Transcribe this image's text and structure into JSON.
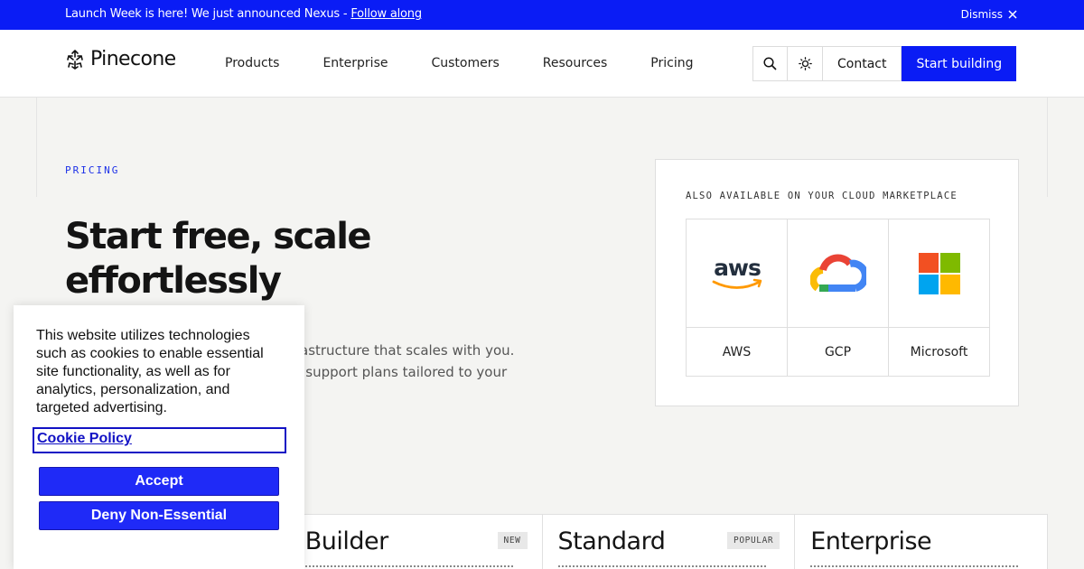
{
  "banner": {
    "text": "Launch Week is here! We just announced Nexus - ",
    "link": "Follow along",
    "dismiss": "Dismiss"
  },
  "nav": {
    "logo": "Pinecone",
    "links": [
      "Products",
      "Enterprise",
      "Customers",
      "Resources",
      "Pricing"
    ],
    "contact": "Contact",
    "cta": "Start building",
    "icons": [
      "search-icon",
      "theme-toggle-icon"
    ]
  },
  "hero": {
    "eyebrow": "PRICING",
    "title": "Start free, scale effortlessly",
    "subtitle_line1": "astructure that scales with you.",
    "subtitle_line2": "d support plans tailored to your"
  },
  "marketplace": {
    "title": "ALSO AVAILABLE ON YOUR CLOUD MARKETPLACE",
    "providers": [
      {
        "label": "AWS",
        "logo_text": "aws",
        "icon": "aws-logo"
      },
      {
        "label": "GCP",
        "icon": "gcp-logo"
      },
      {
        "label": "Microsoft",
        "icon": "microsoft-logo"
      }
    ]
  },
  "plans": [
    {
      "name": "",
      "badge": ""
    },
    {
      "name": "Builder",
      "badge": "NEW"
    },
    {
      "name": "Standard",
      "badge": "POPULAR"
    },
    {
      "name": "Enterprise",
      "badge": ""
    }
  ],
  "cookie": {
    "text": "This website utilizes technologies such as cookies to enable essential site functionality, as well as for analytics, personalization, and targeted advertising.",
    "policy_link": "Cookie Policy",
    "accept": "Accept",
    "deny": "Deny Non-Essential"
  },
  "colors": {
    "brand_blue": "#0a1cf5",
    "cookie_button": "#1f2af7",
    "page_background": "#f4f4f2"
  }
}
